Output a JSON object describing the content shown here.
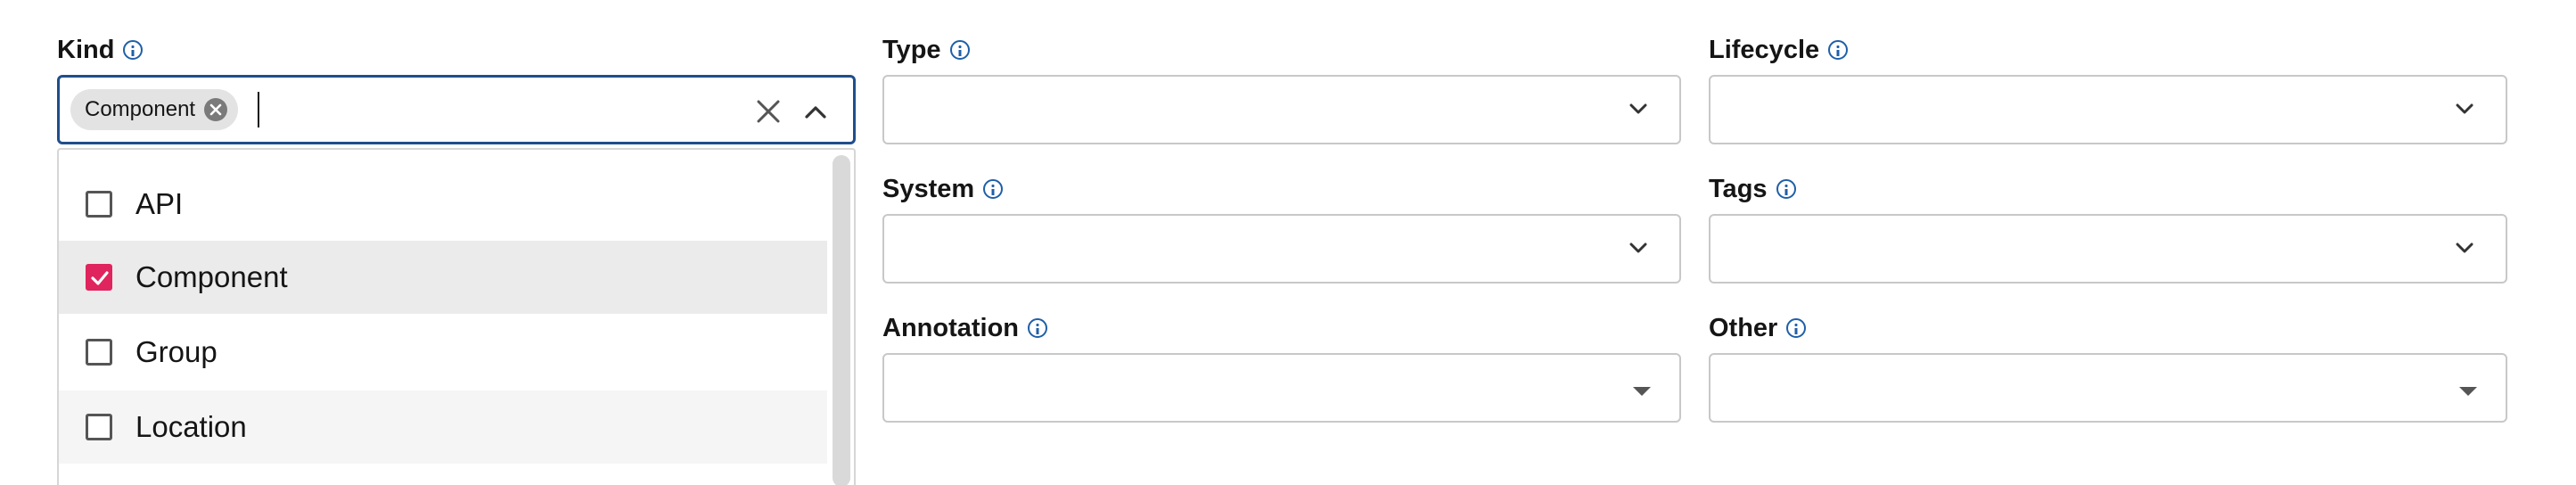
{
  "fields": {
    "kind": {
      "label": "Kind",
      "chip": "Component",
      "options": [
        {
          "label": "API",
          "checked": false
        },
        {
          "label": "Component",
          "checked": true
        },
        {
          "label": "Group",
          "checked": false
        },
        {
          "label": "Location",
          "checked": false
        }
      ]
    },
    "type": {
      "label": "Type"
    },
    "lifecycle": {
      "label": "Lifecycle"
    },
    "system": {
      "label": "System"
    },
    "tags": {
      "label": "Tags"
    },
    "annotation": {
      "label": "Annotation"
    },
    "other": {
      "label": "Other"
    }
  },
  "colors": {
    "accent": "#e0245e",
    "focus_border": "#1f4e8c",
    "info_icon": "#1f5fa8"
  }
}
